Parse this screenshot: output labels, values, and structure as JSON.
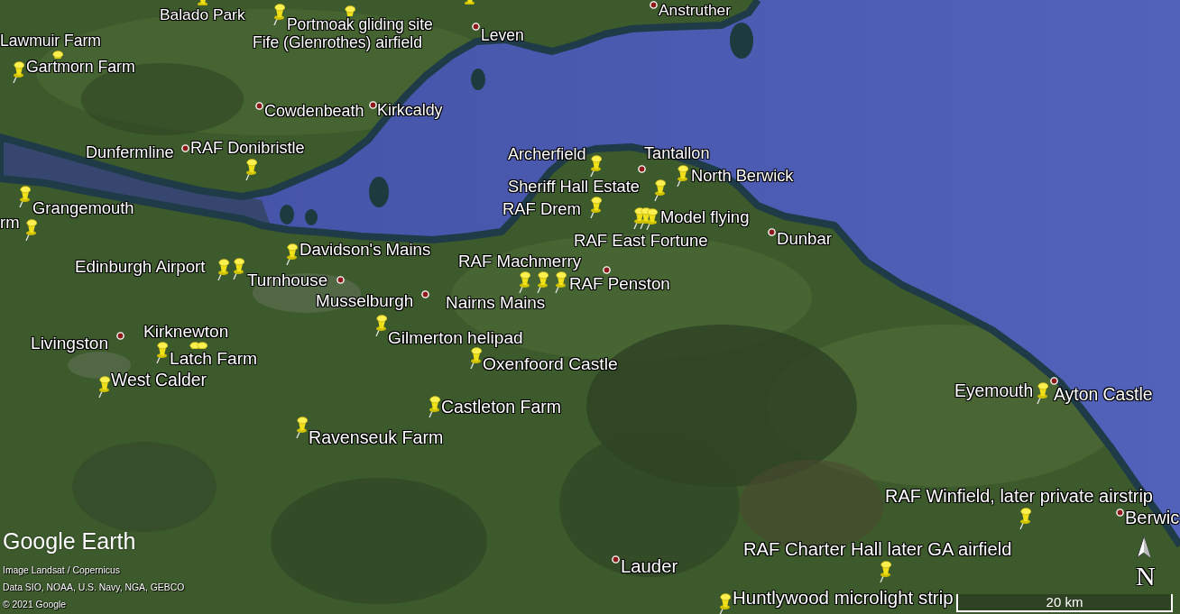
{
  "map": {
    "places": [
      {
        "name": "Balado Park",
        "kind": "placemark"
      },
      {
        "kind": "placemark"
      },
      {
        "name": "Portmoak gliding site",
        "kind": "placemark"
      },
      {
        "name": "Anstruther",
        "kind": "town"
      },
      {
        "name": "Lawmuir Farm",
        "kind": "placemark"
      },
      {
        "name": "Fife (Glenrothes) airfield",
        "kind": "placemark"
      },
      {
        "name": "Leven",
        "kind": "town"
      },
      {
        "name": "Gartmorn Farm",
        "kind": "placemark"
      },
      {
        "name": "Cowdenbeath",
        "kind": "town"
      },
      {
        "name": "Kirkcaldy",
        "kind": "town"
      },
      {
        "name": "Dunfermline",
        "kind": "town"
      },
      {
        "name": "RAF Donibristle",
        "kind": "placemark"
      },
      {
        "name": "Archerfield",
        "kind": "placemark"
      },
      {
        "name": "Tantallon",
        "kind": "placemark"
      },
      {
        "name": "Sheriff Hall Estate",
        "kind": "placemark"
      },
      {
        "name": "North Berwick",
        "kind": "town"
      },
      {
        "name": "rm",
        "kind": "placemark"
      },
      {
        "name": "Grangemouth",
        "kind": "placemark"
      },
      {
        "name": "RAF Drem",
        "kind": "placemark"
      },
      {
        "name": "Model flying",
        "kind": "placemark"
      },
      {
        "name": "Davidson's Mains",
        "kind": "placemark"
      },
      {
        "name": "RAF East Fortune",
        "kind": "placemark"
      },
      {
        "name": "Dunbar",
        "kind": "town"
      },
      {
        "name": "Edinburgh Airport",
        "kind": "placemark"
      },
      {
        "name": "RAF Machmerry",
        "kind": "placemark"
      },
      {
        "name": "Turnhouse",
        "kind": "placemark"
      },
      {
        "kind": "town"
      },
      {
        "name": "RAF Penston",
        "kind": "placemark"
      },
      {
        "kind": "town"
      },
      {
        "name": "Musselburgh",
        "kind": "town"
      },
      {
        "name": "Nairns Mains",
        "kind": "placemark"
      },
      {
        "name": "Livingston",
        "kind": "town"
      },
      {
        "name": "Kirknewton",
        "kind": "placemark"
      },
      {
        "name": "Gilmerton helipad",
        "kind": "placemark"
      },
      {
        "name": "Latch Farm",
        "kind": "placemark"
      },
      {
        "name": "Oxenfoord Castle",
        "kind": "placemark"
      },
      {
        "name": "West Calder",
        "kind": "placemark"
      },
      {
        "name": "Castleton Farm",
        "kind": "placemark"
      },
      {
        "name": "Eyemouth",
        "kind": "town"
      },
      {
        "name": "Ayton Castle",
        "kind": "placemark"
      },
      {
        "name": "Ravenseuk Farm",
        "kind": "placemark"
      },
      {
        "name": "RAF Winfield, later private airstrip",
        "kind": "placemark"
      },
      {
        "name": "Berwic",
        "kind": "town"
      },
      {
        "name": "Lauder",
        "kind": "town"
      },
      {
        "name": "RAF Charter Hall later GA airfield",
        "kind": "placemark"
      },
      {
        "name": "Huntlywood microlight strip",
        "kind": "placemark"
      }
    ]
  },
  "branding": {
    "logo": "Google Earth",
    "credits": [
      "Image Landsat / Copernicus",
      "Data SIO, NOAA, U.S. Navy, NGA, GEBCO",
      "© 2021 Google"
    ]
  },
  "compass": {
    "label": "N"
  },
  "scale_bar": {
    "label": "20 km"
  }
}
